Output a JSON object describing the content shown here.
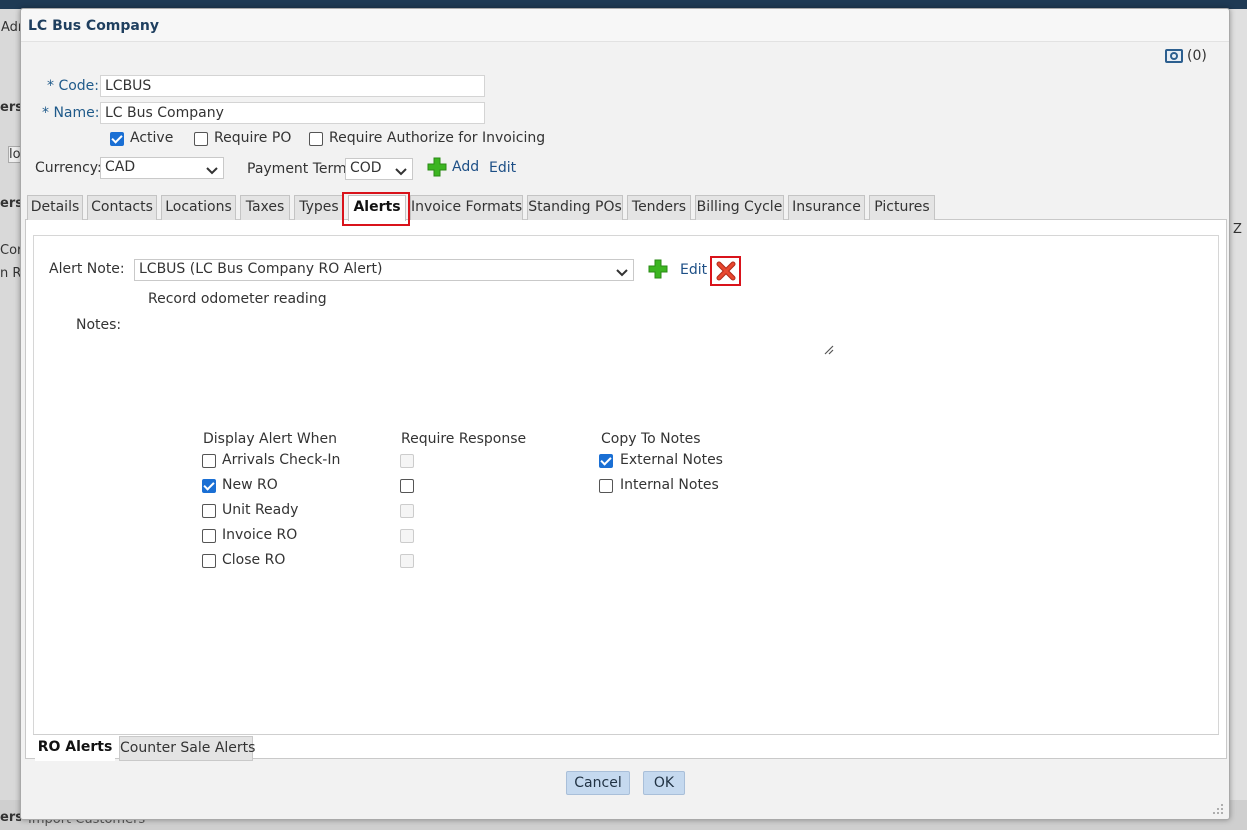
{
  "background": {
    "fragments": [
      "Adr",
      "ers",
      "lo",
      "ers",
      "Cor",
      "n Re",
      "Z",
      "ers",
      "Import Customers"
    ]
  },
  "dialog": {
    "title": "LC Bus Company",
    "camera_count": "(0)"
  },
  "form": {
    "code_label": "* Code:",
    "code_value": "LCBUS",
    "name_label": "* Name:",
    "name_value": "LC Bus Company",
    "active_label": "Active",
    "active_checked": true,
    "require_po_label": "Require PO",
    "require_authorize_label": "Require Authorize for Invoicing",
    "currency_label": "Currency:",
    "currency_value": "CAD",
    "payment_term_label": "Payment Term:",
    "payment_term_value": "COD",
    "add_label": "Add",
    "edit_label": "Edit"
  },
  "tabs": [
    {
      "label": "Details"
    },
    {
      "label": "Contacts"
    },
    {
      "label": "Locations"
    },
    {
      "label": "Taxes"
    },
    {
      "label": "Types"
    },
    {
      "label": "Alerts"
    },
    {
      "label": "Invoice Formats"
    },
    {
      "label": "Standing POs"
    },
    {
      "label": "Tenders"
    },
    {
      "label": "Billing Cycle"
    },
    {
      "label": "Insurance"
    },
    {
      "label": "Pictures"
    }
  ],
  "alerts": {
    "alert_note_label": "Alert Note:",
    "alert_note_value": "LCBUS (LC Bus Company RO Alert)",
    "edit_label": "Edit",
    "message": "Record odometer reading",
    "notes_label": "Notes:",
    "col_display": "Display Alert When",
    "col_require": "Require Response",
    "col_copy": "Copy To Notes",
    "rows": [
      {
        "label": "Arrivals Check-In"
      },
      {
        "label": "New RO"
      },
      {
        "label": "Unit Ready"
      },
      {
        "label": "Invoice RO"
      },
      {
        "label": "Close RO"
      }
    ],
    "external_notes": "External Notes",
    "internal_notes": "Internal Notes"
  },
  "bottom_tabs": [
    {
      "label": "RO Alerts"
    },
    {
      "label": "Counter Sale Alerts"
    }
  ],
  "buttons": {
    "cancel": "Cancel",
    "ok": "OK"
  },
  "colors": {
    "accent_blue": "#1a6fd4",
    "highlight_red": "#d9131b",
    "add_green": "#3cb521",
    "title_color": "#1f3f5f"
  }
}
